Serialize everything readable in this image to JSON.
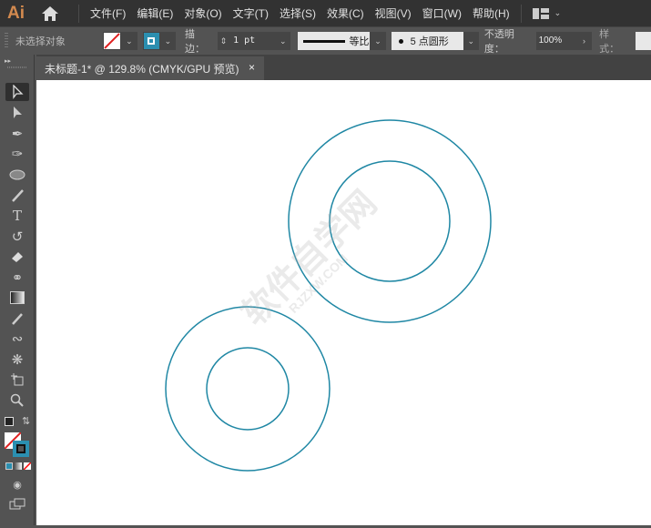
{
  "app": {
    "logo": "Ai"
  },
  "menus": [
    "文件(F)",
    "编辑(E)",
    "对象(O)",
    "文字(T)",
    "选择(S)",
    "效果(C)",
    "视图(V)",
    "窗口(W)",
    "帮助(H)"
  ],
  "control": {
    "selection": "未选择对象",
    "stroke_label": "描边：",
    "stroke_weight": "1 pt",
    "profile": "等比",
    "brush": "5 点圆形",
    "opacity_label": "不透明度：",
    "opacity": "100%",
    "style_label": "样式："
  },
  "document": {
    "tab_title": "未标题-1* @ 129.8% (CMYK/GPU 预览)",
    "close": "×"
  },
  "colors": {
    "stroke": "#1f87a4",
    "accent": "#2b8fb0"
  },
  "watermark": {
    "text": "软件自学网",
    "url": "RJZXW.COM"
  }
}
